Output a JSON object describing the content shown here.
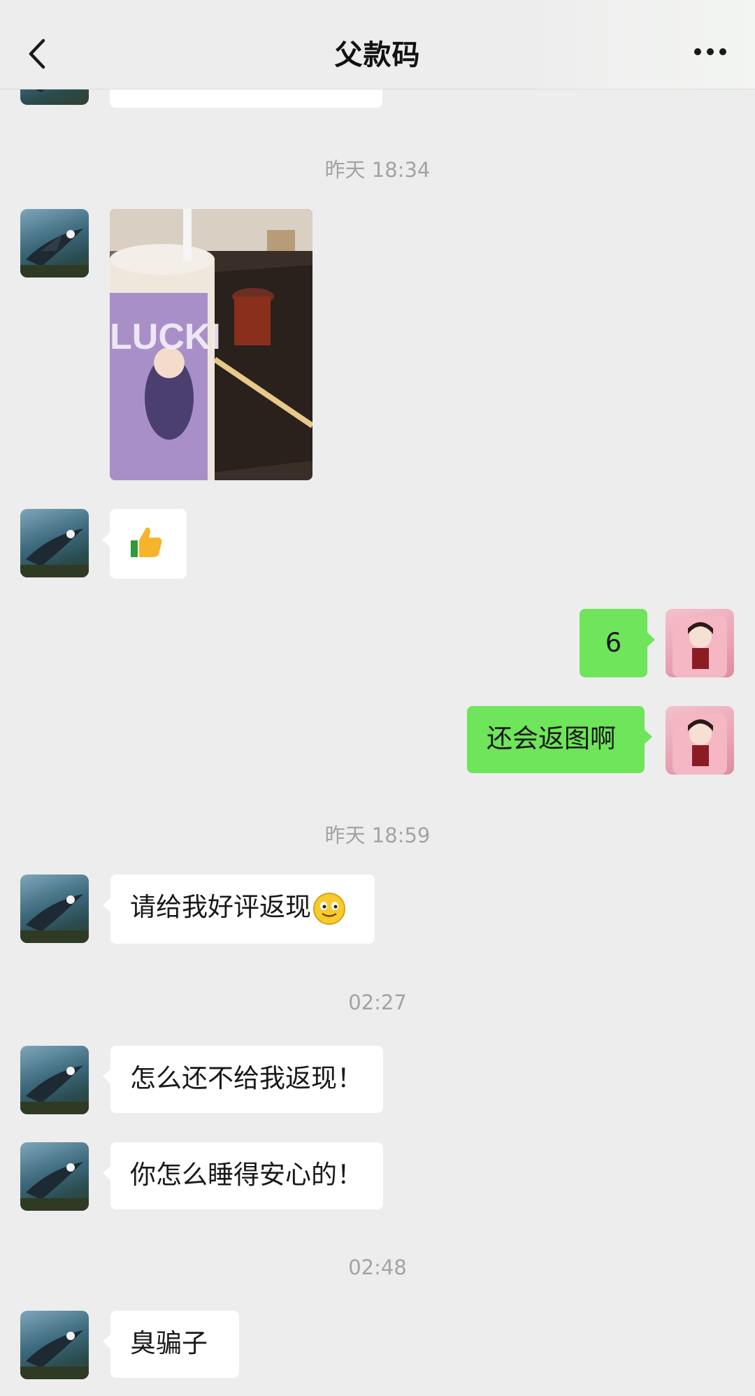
{
  "header": {
    "title": "父款码",
    "back_icon": "chevron-left-icon",
    "more_icon": "more-dots-icon"
  },
  "messages": {
    "time_1": "昨天 18:34",
    "time_2": "昨天 18:59",
    "time_3": "02:27",
    "time_4": "02:48",
    "reply_1": "6",
    "reply_2": "还会返图啊",
    "msg_1": "请给我好评返现",
    "msg_2": "怎么还不给我返现！",
    "msg_3": "你怎么睡得安心的！",
    "msg_4": "臭骗子"
  },
  "photo": {
    "cup_text": "LUCKI"
  },
  "icons": {
    "thumbs_up": "thumbs-up-icon",
    "smile": "smile-emoji-icon"
  },
  "colors": {
    "background": "#ededed",
    "incoming_bubble": "#ffffff",
    "outgoing_bubble": "#6ee55a",
    "timestamp": "#a3a3a3"
  }
}
